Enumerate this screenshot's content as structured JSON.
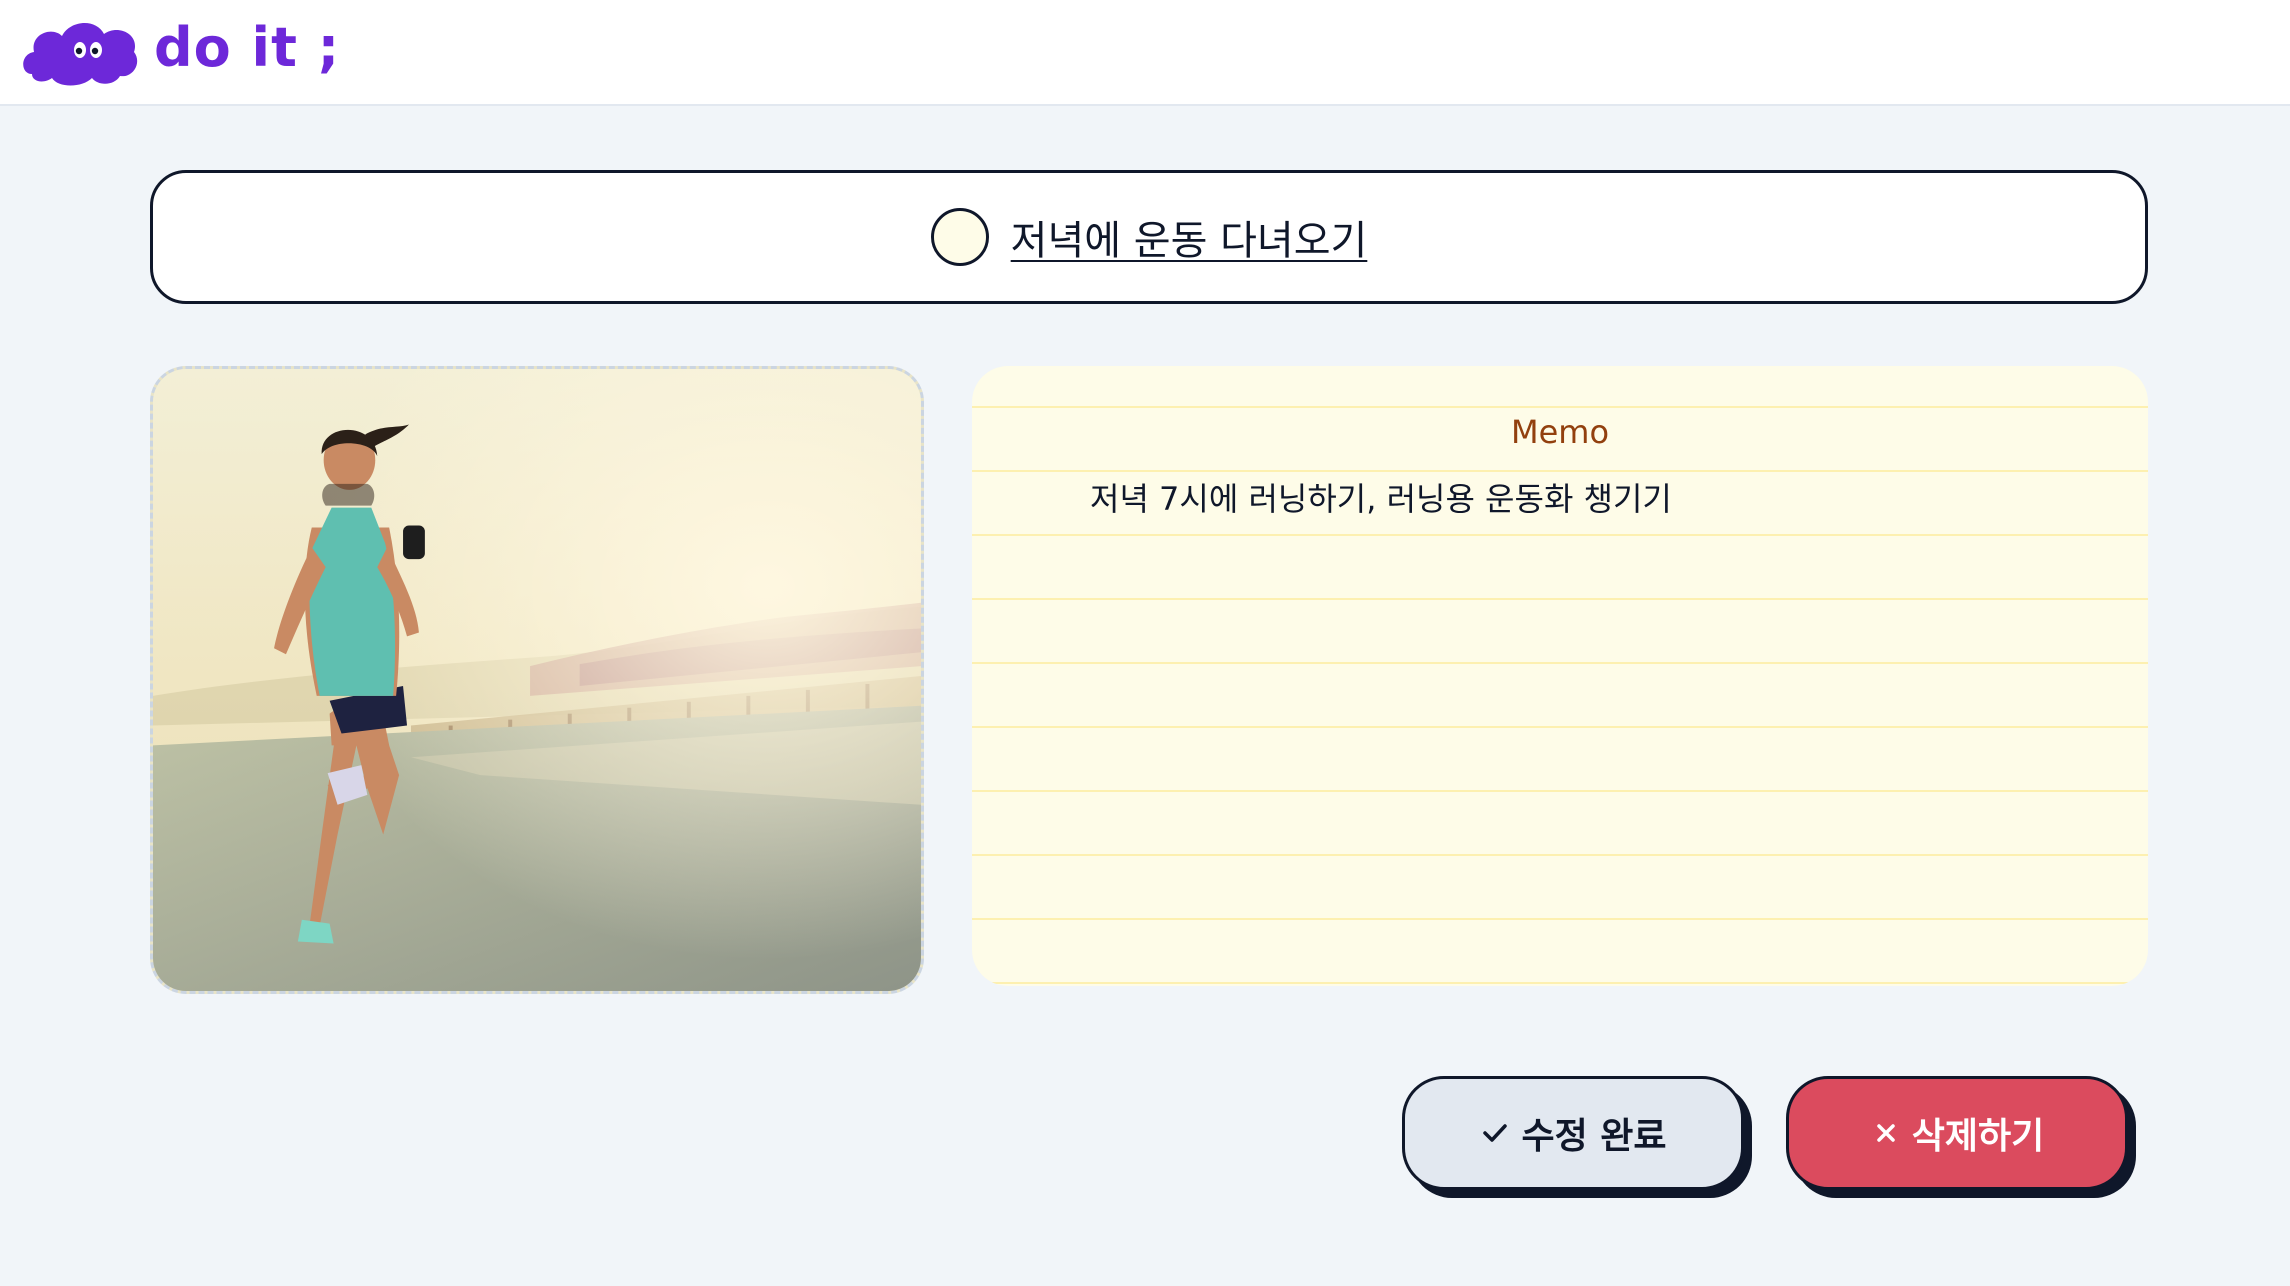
{
  "header": {
    "logo_text": "do it ;",
    "logo_icon": "purple-cloud-icon"
  },
  "todo": {
    "title": "저녁에 운동 다녀오기",
    "completed": false
  },
  "image": {
    "description_icon": "running-woman-photo"
  },
  "memo": {
    "heading": "Memo",
    "text": "저녁 7시에 러닝하기, 러닝용 운동화 챙기기"
  },
  "buttons": {
    "edit_label": "수정 완료",
    "edit_icon": "check-icon",
    "delete_label": "삭제하기",
    "delete_icon": "close-icon"
  },
  "colors": {
    "brand": "#6D28D9",
    "background": "#F1F5F9",
    "memo_bg": "#FEFCE8",
    "memo_heading": "#92400E",
    "delete": "#DB4B5E",
    "edit": "#E2E8F0"
  }
}
